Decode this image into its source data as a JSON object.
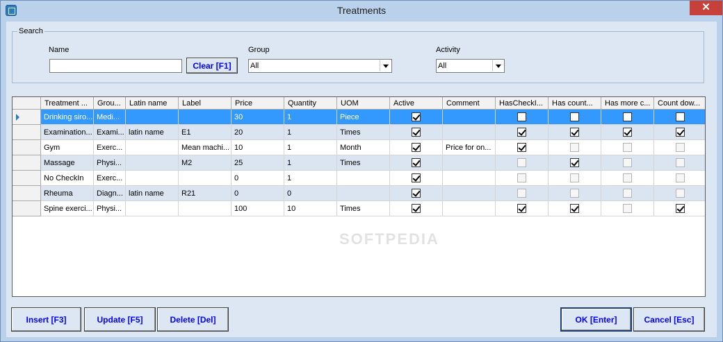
{
  "window": {
    "title": "Treatments",
    "close_glyph": "✕"
  },
  "search": {
    "legend": "Search",
    "name_label": "Name",
    "name_value": "",
    "clear_button": "Clear [F1]",
    "group_label": "Group",
    "group_value": "All",
    "activity_label": "Activity",
    "activity_value": "All"
  },
  "grid": {
    "columns": [
      "Treatment ...",
      "Grou...",
      "Latin name",
      "Label",
      "Price",
      "Quantity",
      "UOM",
      "Active",
      "Comment",
      "HasCheckI...",
      "Has count...",
      "Has more c...",
      "Count dow..."
    ],
    "rows": [
      {
        "name": "Drinking siro...",
        "group": "Medi...",
        "latin": "",
        "label": "",
        "price": "30",
        "qty": "1",
        "uom": "Piece",
        "active": true,
        "comment": "",
        "checkin": false,
        "count": false,
        "more": false,
        "countdown": false,
        "checkin_enabled": true,
        "count_enabled": true,
        "more_enabled": true,
        "countdown_enabled": true
      },
      {
        "name": "Examination...",
        "group": "Exami...",
        "latin": "latin name",
        "label": "E1",
        "price": "20",
        "qty": "1",
        "uom": "Times",
        "active": true,
        "comment": "",
        "checkin": true,
        "count": true,
        "more": true,
        "countdown": true,
        "checkin_enabled": true,
        "count_enabled": true,
        "more_enabled": true,
        "countdown_enabled": true
      },
      {
        "name": "Gym",
        "group": "Exerc...",
        "latin": "",
        "label": "Mean machi...",
        "price": "10",
        "qty": "1",
        "uom": "Month",
        "active": true,
        "comment": "Price for on...",
        "checkin": true,
        "count": false,
        "more": false,
        "countdown": false,
        "checkin_enabled": true,
        "count_enabled": false,
        "more_enabled": false,
        "countdown_enabled": false
      },
      {
        "name": "Massage",
        "group": "Physi...",
        "latin": "",
        "label": "M2",
        "price": "25",
        "qty": "1",
        "uom": "Times",
        "active": true,
        "comment": "",
        "checkin": false,
        "count": true,
        "more": false,
        "countdown": false,
        "checkin_enabled": false,
        "count_enabled": true,
        "more_enabled": false,
        "countdown_enabled": false
      },
      {
        "name": "No CheckIn",
        "group": "Exerc...",
        "latin": "",
        "label": "",
        "price": "0",
        "qty": "1",
        "uom": "",
        "active": true,
        "comment": "",
        "checkin": false,
        "count": false,
        "more": false,
        "countdown": false,
        "checkin_enabled": false,
        "count_enabled": false,
        "more_enabled": false,
        "countdown_enabled": false
      },
      {
        "name": "Rheuma",
        "group": "Diagn...",
        "latin": "latin name",
        "label": "R21",
        "price": "0",
        "qty": "0",
        "uom": "",
        "active": true,
        "comment": "",
        "checkin": false,
        "count": false,
        "more": false,
        "countdown": false,
        "checkin_enabled": false,
        "count_enabled": false,
        "more_enabled": false,
        "countdown_enabled": false
      },
      {
        "name": "Spine exerci...",
        "group": "Physi...",
        "latin": "",
        "label": "",
        "price": "100",
        "qty": "10",
        "uom": "Times",
        "active": true,
        "comment": "",
        "checkin": true,
        "count": true,
        "more": false,
        "countdown": true,
        "checkin_enabled": true,
        "count_enabled": true,
        "more_enabled": false,
        "countdown_enabled": true
      }
    ]
  },
  "buttons": {
    "insert": "Insert [F3]",
    "update": "Update [F5]",
    "delete": "Delete [Del]",
    "ok": "OK [Enter]",
    "cancel": "Cancel [Esc]"
  },
  "watermark": "SOFTPEDIA",
  "colors": {
    "selected_row": "#3399ff",
    "alt_row": "#dbe5f1",
    "button_text": "#0000ff",
    "close_button": "#c7403a"
  }
}
